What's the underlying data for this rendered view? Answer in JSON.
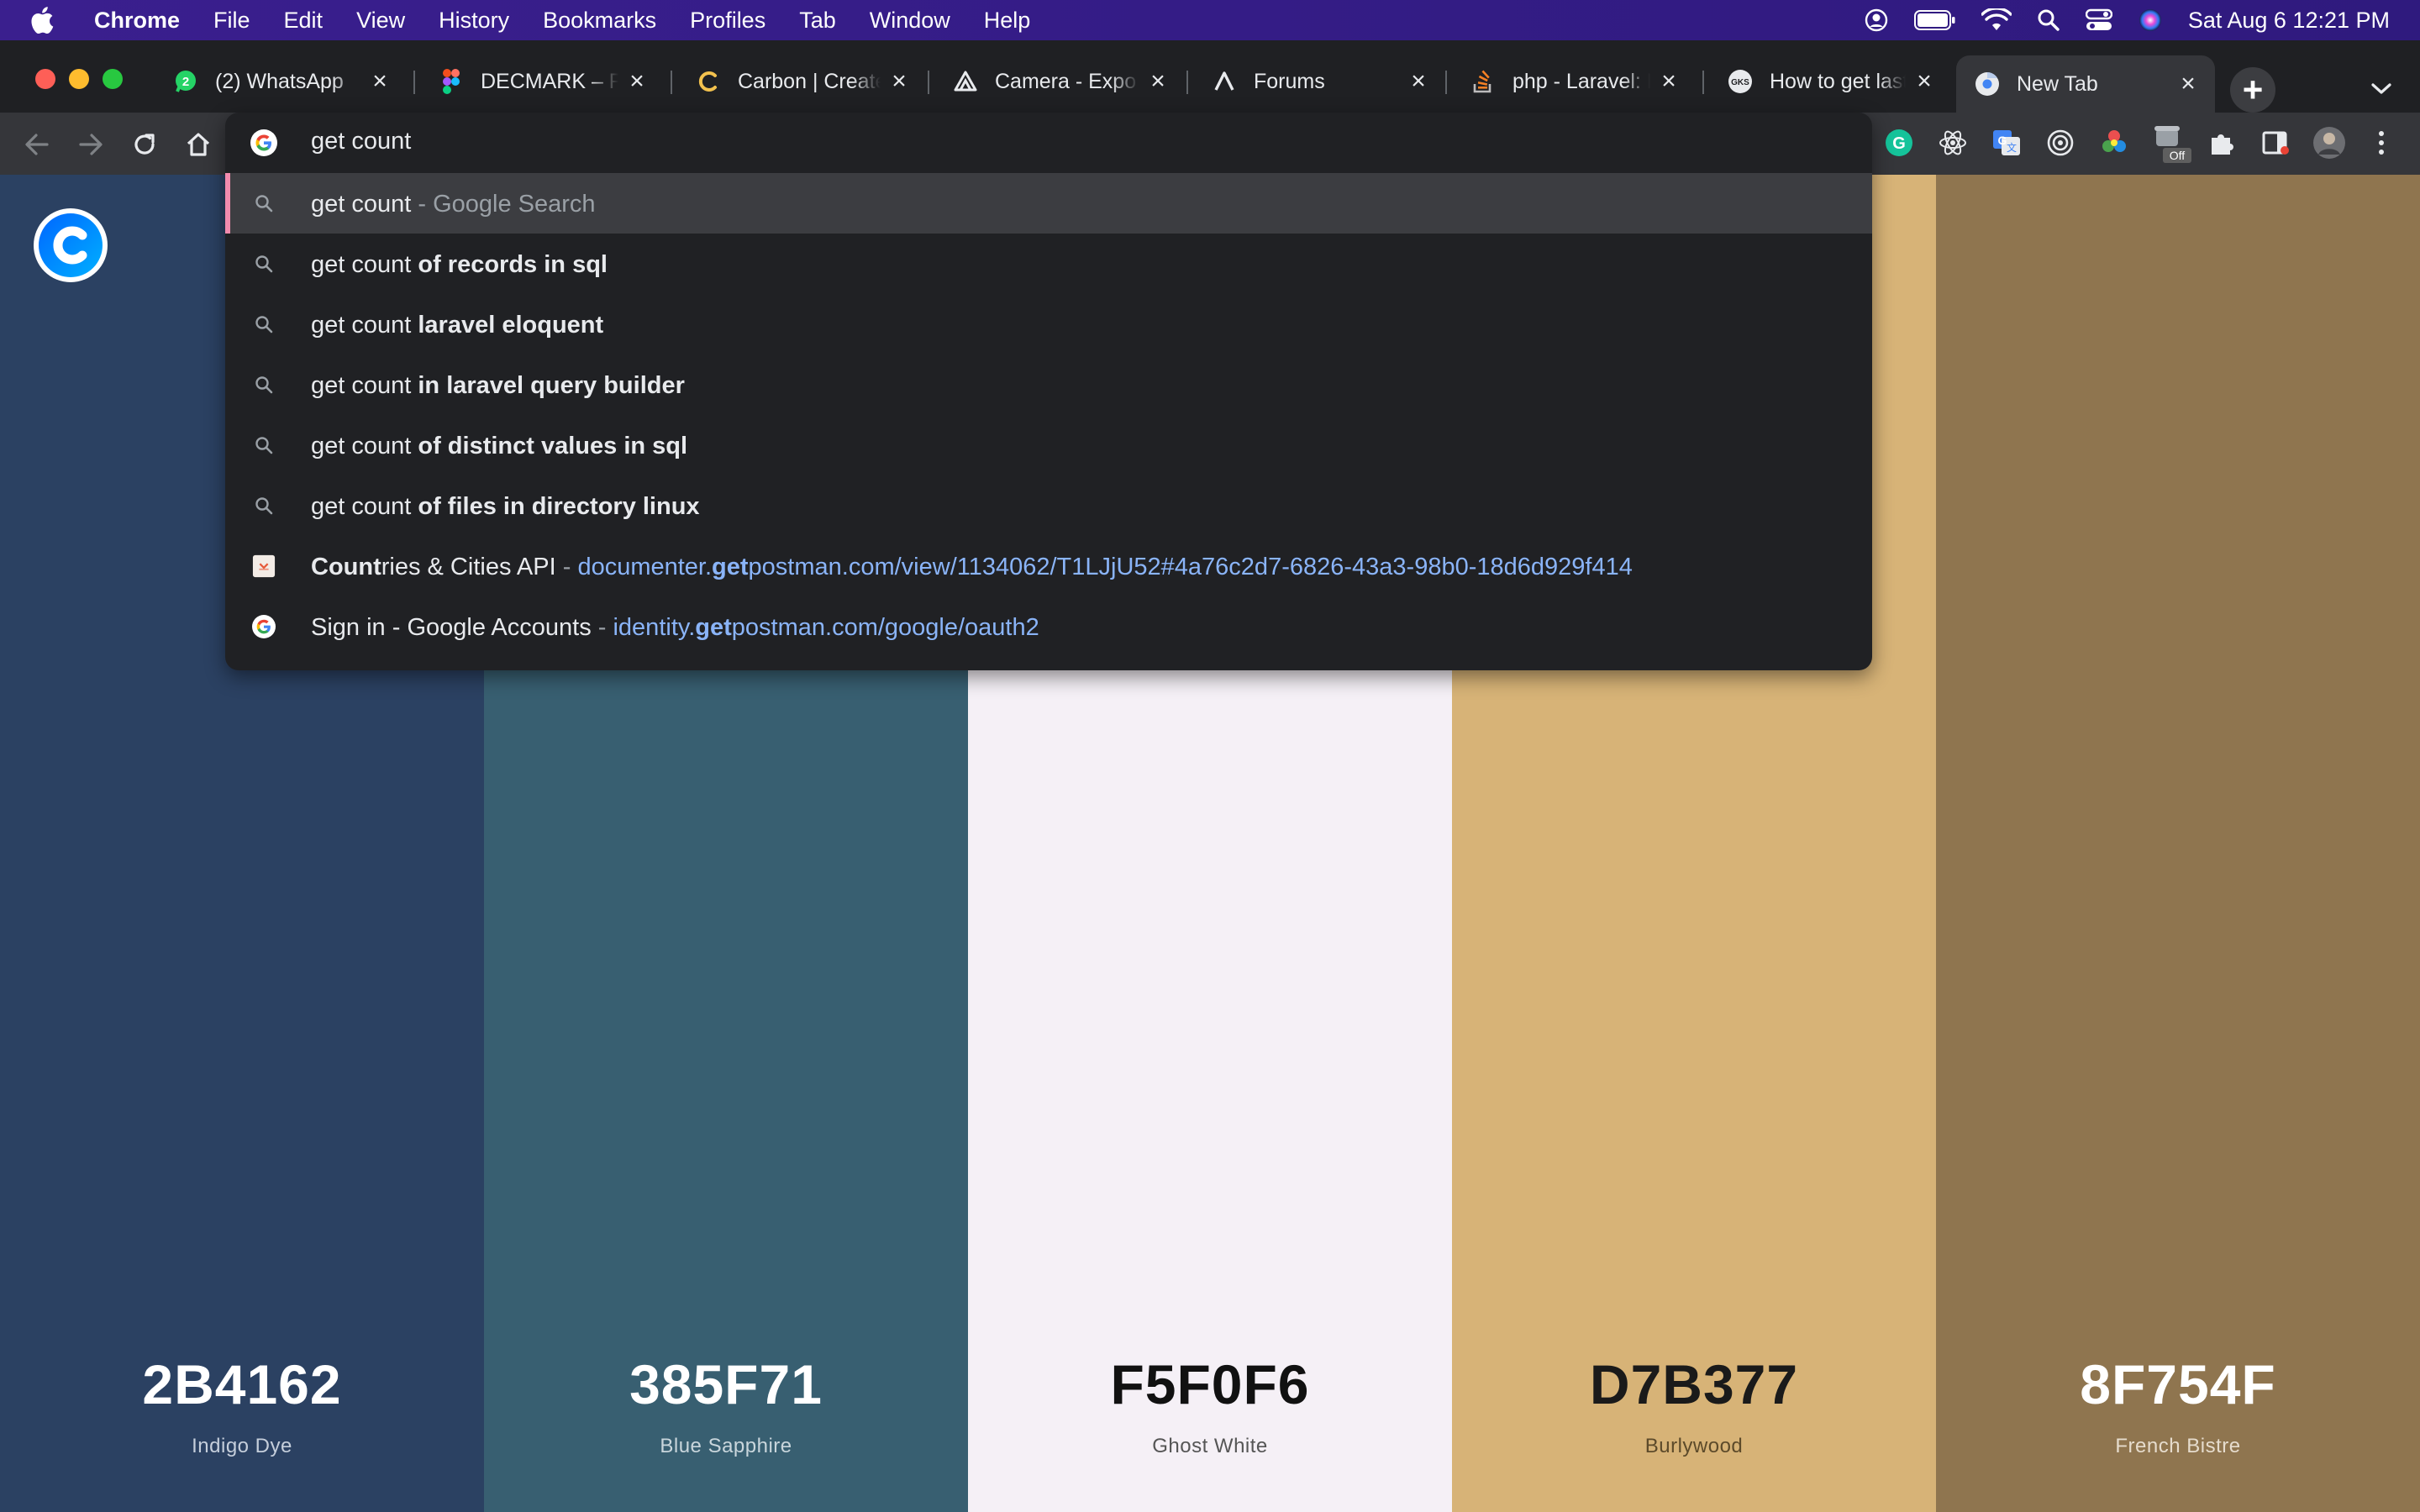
{
  "menubar": {
    "app_name": "Chrome",
    "items": [
      "File",
      "Edit",
      "View",
      "History",
      "Bookmarks",
      "Profiles",
      "Tab",
      "Window",
      "Help"
    ],
    "clock": "Sat Aug 6  12:21 PM"
  },
  "tabs": [
    {
      "title": "(2) WhatsApp",
      "icon": "whatsapp-icon"
    },
    {
      "title": "DECMARK – Figma",
      "icon": "figma-icon"
    },
    {
      "title": "Carbon | Create and share",
      "icon": "carbon-icon"
    },
    {
      "title": "Camera - Expo Documentation",
      "icon": "expo-icon"
    },
    {
      "title": "Forums",
      "icon": "laravel-forums-icon"
    },
    {
      "title": "php - Laravel: How to",
      "icon": "stackoverflow-icon"
    },
    {
      "title": "How to get last",
      "icon": "site-icon"
    },
    {
      "title": "New Tab",
      "icon": "chrome-icon",
      "active": true
    }
  ],
  "toolbar": {
    "extension_badge": "Off"
  },
  "omnibox": {
    "query": "get count",
    "suggestions": [
      {
        "type": "search",
        "typed": "get count",
        "completion": "",
        "suffix": " - Google Search",
        "selected": true
      },
      {
        "type": "search",
        "typed": "get count ",
        "completion": "of records in sql"
      },
      {
        "type": "search",
        "typed": "get count ",
        "completion": "laravel eloquent"
      },
      {
        "type": "search",
        "typed": "get count ",
        "completion": "in laravel query builder"
      },
      {
        "type": "search",
        "typed": "get count ",
        "completion": "of distinct values in sql"
      },
      {
        "type": "search",
        "typed": "get count ",
        "completion": "of files in directory linux"
      },
      {
        "type": "history",
        "title_bold": "Count",
        "title_rest": "ries & Cities API",
        "separator": " - ",
        "url_pre": "documenter.",
        "url_bold": "get",
        "url_post": "postman.com/view/1134062/T1LJjU52#4a76c2d7-6826-43a3-98b0-18d6d929f414"
      },
      {
        "type": "history",
        "title_bold": "",
        "title_rest": "Sign in - Google Accounts",
        "separator": " - ",
        "url_pre": "identity.",
        "url_bold": "get",
        "url_post": "postman.com/google/oauth2"
      }
    ]
  },
  "palette": [
    {
      "hex": "2B4162",
      "name": "Indigo Dye",
      "color": "#2b4162",
      "text_color": "#ffffff",
      "name_color": "#c5cedb"
    },
    {
      "hex": "385F71",
      "name": "Blue Sapphire",
      "color": "#385f71",
      "text_color": "#ffffff",
      "name_color": "#c9d6dc"
    },
    {
      "hex": "F5F0F6",
      "name": "Ghost White",
      "color": "#f5f0f6",
      "text_color": "#111111",
      "name_color": "#555555"
    },
    {
      "hex": "D7B377",
      "name": "Burlywood",
      "color": "#d7b377",
      "text_color": "#1a1a1a",
      "name_color": "#5c4a2a"
    },
    {
      "hex": "8F754F",
      "name": "French Bistre",
      "color": "#8f754f",
      "text_color": "#ffffff",
      "name_color": "#e6dccd"
    }
  ]
}
